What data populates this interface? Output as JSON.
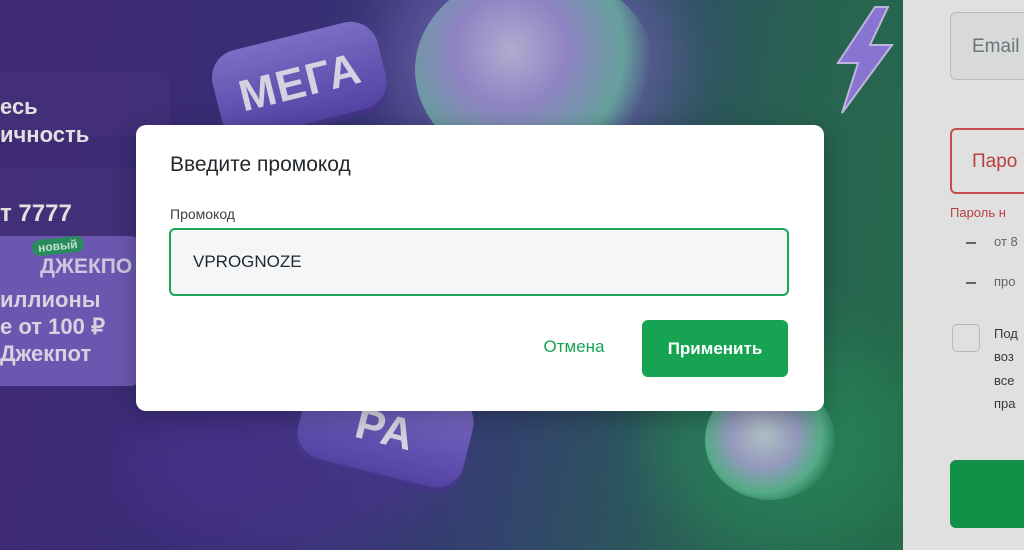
{
  "background": {
    "promo_lines": [
      "есь",
      "ичность",
      "т 7777"
    ],
    "jackpot_card": {
      "badge": "новый",
      "title": "ДЖЕКПО",
      "lines": [
        "иллионы",
        "е от 100 ₽",
        "Джекпот"
      ]
    },
    "badge_mega": "МЕГА",
    "badge_igra": "РА"
  },
  "register_form": {
    "email_placeholder": "Email",
    "password_placeholder": "Паро",
    "password_error": "Пароль н",
    "rules": [
      "от 8",
      "про"
    ],
    "consent_lines": [
      "Под",
      "воз",
      "все",
      "пра"
    ]
  },
  "modal": {
    "title": "Введите промокод",
    "field_label": "Промокод",
    "promo_value": "VPROGNOZE",
    "cancel_label": "Отмена",
    "apply_label": "Применить"
  },
  "colors": {
    "accent_green": "#16a452",
    "error_red": "#d44a4a"
  }
}
